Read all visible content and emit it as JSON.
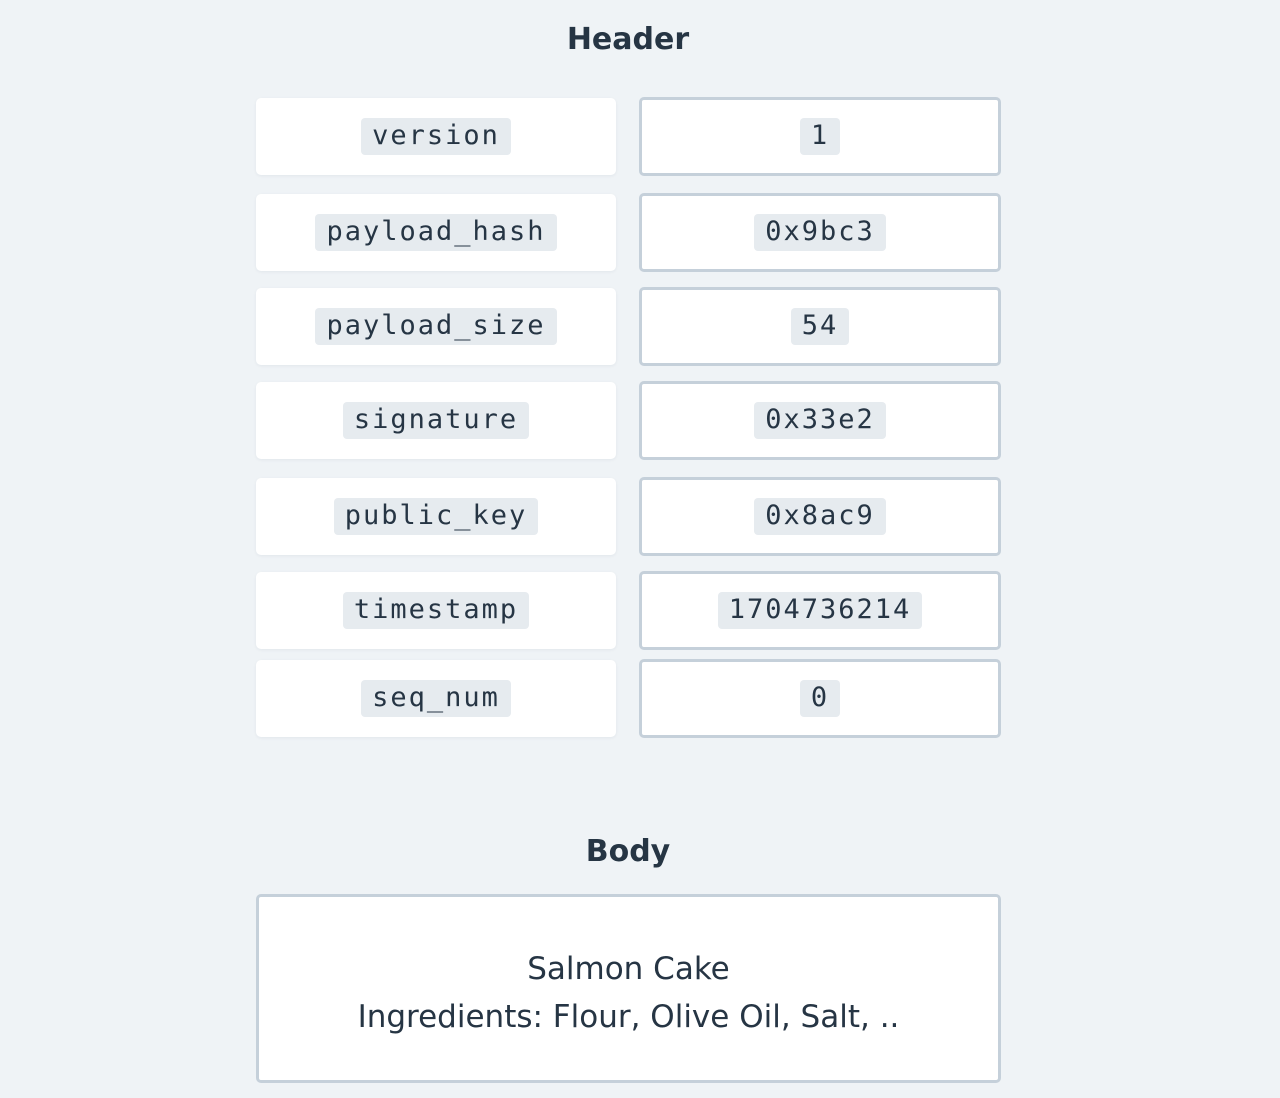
{
  "header": {
    "title": "Header",
    "fields": [
      {
        "key": "version",
        "value": "1"
      },
      {
        "key": "payload_hash",
        "value": "0x9bc3"
      },
      {
        "key": "payload_size",
        "value": "54"
      },
      {
        "key": "signature",
        "value": "0x33e2"
      },
      {
        "key": "public_key",
        "value": "0x8ac9"
      },
      {
        "key": "timestamp",
        "value": "1704736214"
      },
      {
        "key": "seq_num",
        "value": "0"
      }
    ]
  },
  "body": {
    "title": "Body",
    "name": "Salmon Cake",
    "ingredients": "Ingredients: Flour, Olive Oil, Salt, .."
  },
  "colors": {
    "background": "#eff3f6",
    "text": "#263544",
    "border": "#c5d0da",
    "code_background": "#e6ebef"
  }
}
